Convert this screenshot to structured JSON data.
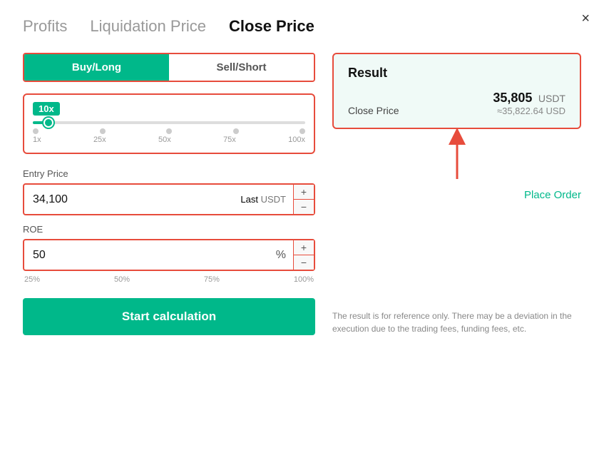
{
  "modal": {
    "close_label": "×"
  },
  "tabs": [
    {
      "id": "profits",
      "label": "Profits",
      "active": false
    },
    {
      "id": "liquidation",
      "label": "Liquidation Price",
      "active": false
    },
    {
      "id": "close-price",
      "label": "Close Price",
      "active": true
    }
  ],
  "left": {
    "direction": {
      "buy_label": "Buy/Long",
      "sell_label": "Sell/Short"
    },
    "leverage": {
      "badge": "10x",
      "labels": [
        "1x",
        "25x",
        "50x",
        "75x",
        "100x"
      ]
    },
    "entry_price": {
      "label": "Entry Price",
      "value": "34,100",
      "tag_last": "Last",
      "tag_unit": "USDT",
      "plus": "+",
      "minus": "−"
    },
    "roe": {
      "label": "ROE",
      "value": "50",
      "unit": "%",
      "plus": "+",
      "minus": "−",
      "labels": [
        "25%",
        "50%",
        "75%",
        "100%"
      ]
    },
    "calc_button": "Start calculation"
  },
  "right": {
    "result": {
      "title": "Result",
      "close_price_label": "Close Price",
      "close_price_value": "35,805",
      "close_price_unit": "USDT",
      "close_price_approx": "≈35,822.64 USD"
    },
    "place_order": "Place Order",
    "disclaimer": "The result is for reference only. There may be a deviation in the execution due to the trading fees, funding fees, etc."
  }
}
